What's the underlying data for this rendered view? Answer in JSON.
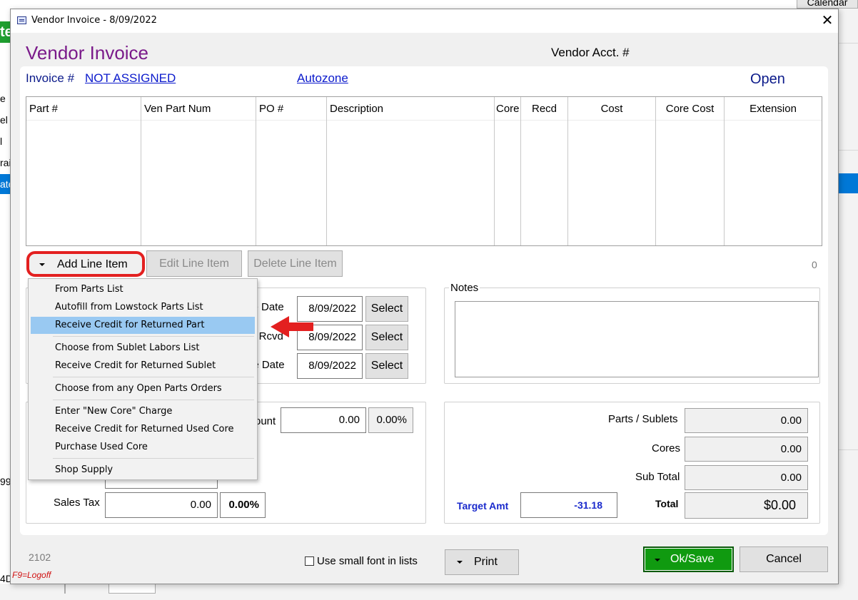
{
  "background_app": {
    "calendar_label": "Calendar",
    "left_fragments": [
      "te",
      "e",
      "el",
      "l",
      "rai",
      "ate",
      "99",
      "4D"
    ]
  },
  "dialog": {
    "title": "Vendor Invoice -  8/09/2022",
    "close_glyph": "✕",
    "heading": "Vendor Invoice",
    "vendor_acct_label": "Vendor Acct. #",
    "invoice_label": "Invoice #",
    "invoice_number": "NOT ASSIGNED",
    "vendor_name": "Autozone",
    "status": "Open"
  },
  "grid": {
    "columns": [
      "Part #",
      "Ven Part Num",
      "PO #",
      "Description",
      "Core",
      "Recd",
      "Cost",
      "Core Cost",
      "Extension"
    ]
  },
  "line_buttons": {
    "add": "Add Line Item",
    "edit": "Edit Line Item",
    "delete": "Delete Line Item",
    "count": "0"
  },
  "add_menu": {
    "items": [
      "From Parts List",
      "Autofill from Lowstock Parts List",
      "Receive Credit for Returned Part",
      "Choose from Sublet Labors List",
      "Receive Credit for Returned Sublet",
      "Choose from any Open Parts Orders",
      "Enter \"New Core\" Charge",
      "Receive Credit for Returned Used Core",
      "Purchase Used Core",
      "Shop Supply"
    ],
    "selected": "Receive Credit for Returned Part"
  },
  "dates": {
    "invoice_date_label": "ce Date",
    "invoice_date": "8/09/2022",
    "received_label": "te Rcvd",
    "received_date": "8/09/2022",
    "due_label": "ue Date",
    "due_date": "8/09/2022",
    "select_label": "Select"
  },
  "notes": {
    "label": "Notes"
  },
  "discount": {
    "label": "ount",
    "amount": "0.00",
    "percent": "0.00%"
  },
  "tax": {
    "label": "Sales Tax",
    "amount": "0.00",
    "percent": "0.00%"
  },
  "totals": {
    "parts_label": "Parts / Sublets",
    "parts_value": "0.00",
    "cores_label": "Cores",
    "cores_value": "0.00",
    "subtotal_label": "Sub Total",
    "subtotal_value": "0.00",
    "total_label": "Total",
    "total_value": "$0.00",
    "target_label": "Target Amt",
    "target_value": "-31.18"
  },
  "footer": {
    "code": "2102",
    "logoff": "F9=Logoff",
    "small_font_label": "Use small font in lists",
    "print": "Print",
    "ok_save": "Ok/Save",
    "cancel": "Cancel"
  },
  "colors": {
    "heading": "#7a1a8a",
    "link": "#0b1acc",
    "highlight_ring": "#e32020",
    "ok_button": "#109a10",
    "menu_selection": "#99c9f2",
    "target_text": "#1a2acc"
  }
}
